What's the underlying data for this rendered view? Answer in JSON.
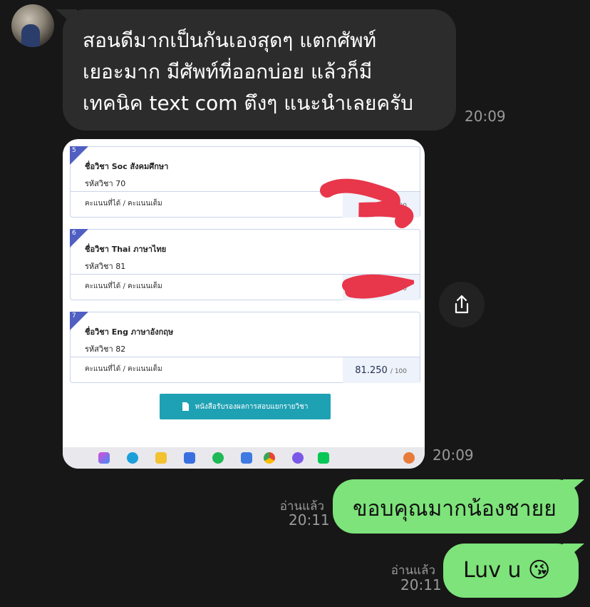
{
  "chat": {
    "incoming": {
      "text": "สอนดีมากเป็นกันเองสุดๆ แตกศัพท์\nเยอะมาก มีศัพท์ที่ออกบ่อย แล้วก็มี\nเทคนิค text com ตึงๆ แนะนำเลยครับ",
      "time": "20:09"
    },
    "image_message": {
      "time": "20:09",
      "grades": [
        {
          "index": "5",
          "subject": "ชื่อวิชา Soc สังคมศึกษา",
          "code": "รหัสวิชา 70",
          "score_label": "คะแนนที่ได้ / คะแนนเต็ม",
          "score": "",
          "max": "/ 100"
        },
        {
          "index": "6",
          "subject": "ชื่อวิชา Thai ภาษาไทย",
          "code": "รหัสวิชา 81",
          "score_label": "คะแนนที่ได้ / คะแนนเต็ม",
          "score": "",
          "max": "/ 100"
        },
        {
          "index": "7",
          "subject": "ชื่อวิชา Eng ภาษาอังกฤษ",
          "code": "รหัสวิชา 82",
          "score_label": "คะแนนที่ได้ / คะแนนเต็ม",
          "score": "81.250",
          "max": "/ 100"
        }
      ],
      "button_label": "หนังสือรับรองผลการสอบแยกรายวิชา"
    },
    "outgoing": [
      {
        "text": "ขอบคุณมากน้องชายย",
        "read": "อ่านแล้ว",
        "time": "20:11"
      },
      {
        "text": "Luv u 😘",
        "read": "อ่านแล้ว",
        "time": "20:11"
      }
    ]
  },
  "icons": {
    "share": "share-icon",
    "pdf": "pdf-file-icon"
  },
  "colors": {
    "background": "#171717",
    "incoming_bubble": "#2c2c2c",
    "outgoing_bubble": "#7de37a",
    "accent_blue": "#4f5fc2",
    "button_teal": "#1fa1b4",
    "redaction": "#e8364a"
  }
}
